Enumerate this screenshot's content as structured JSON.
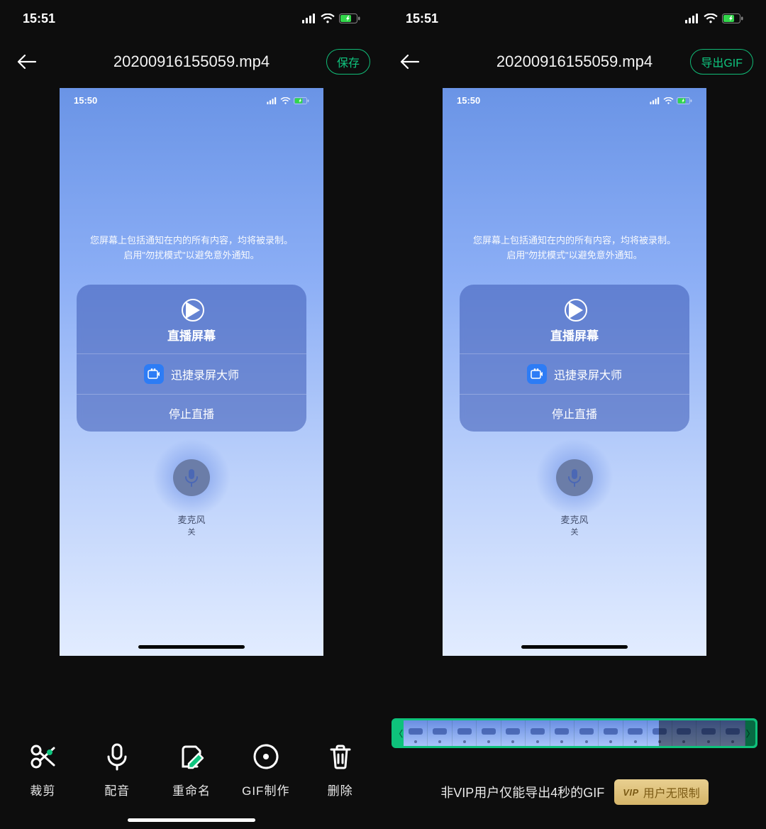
{
  "status": {
    "time": "15:51"
  },
  "inner_status": {
    "time": "15:50"
  },
  "nav": {
    "title": "20200916155059.mp4",
    "save_label": "保存",
    "export_gif_label": "导出GIF"
  },
  "preview": {
    "notice_line1": "您屏幕上包括通知在内的所有内容，均将被录制。",
    "notice_line2": "启用\"勿扰模式\"以避免意外通知。",
    "card": {
      "title": "直播屏幕",
      "app_name": "迅捷录屏大师",
      "stop_label": "停止直播"
    },
    "mic": {
      "label": "麦克风",
      "state": "关"
    }
  },
  "toolbar_left": [
    {
      "icon": "scissors-icon",
      "label": "裁剪"
    },
    {
      "icon": "mic-icon",
      "label": "配音"
    },
    {
      "icon": "edit-icon",
      "label": "重命名"
    },
    {
      "icon": "gif-icon",
      "label": "GIF制作"
    },
    {
      "icon": "trash-icon",
      "label": "删除"
    }
  ],
  "right_footer": {
    "notice": "非VIP用户仅能导出4秒的GIF",
    "vip_logo": "VIP",
    "vip_label": "用户无限制"
  },
  "colors": {
    "accent": "#0fc47e"
  }
}
